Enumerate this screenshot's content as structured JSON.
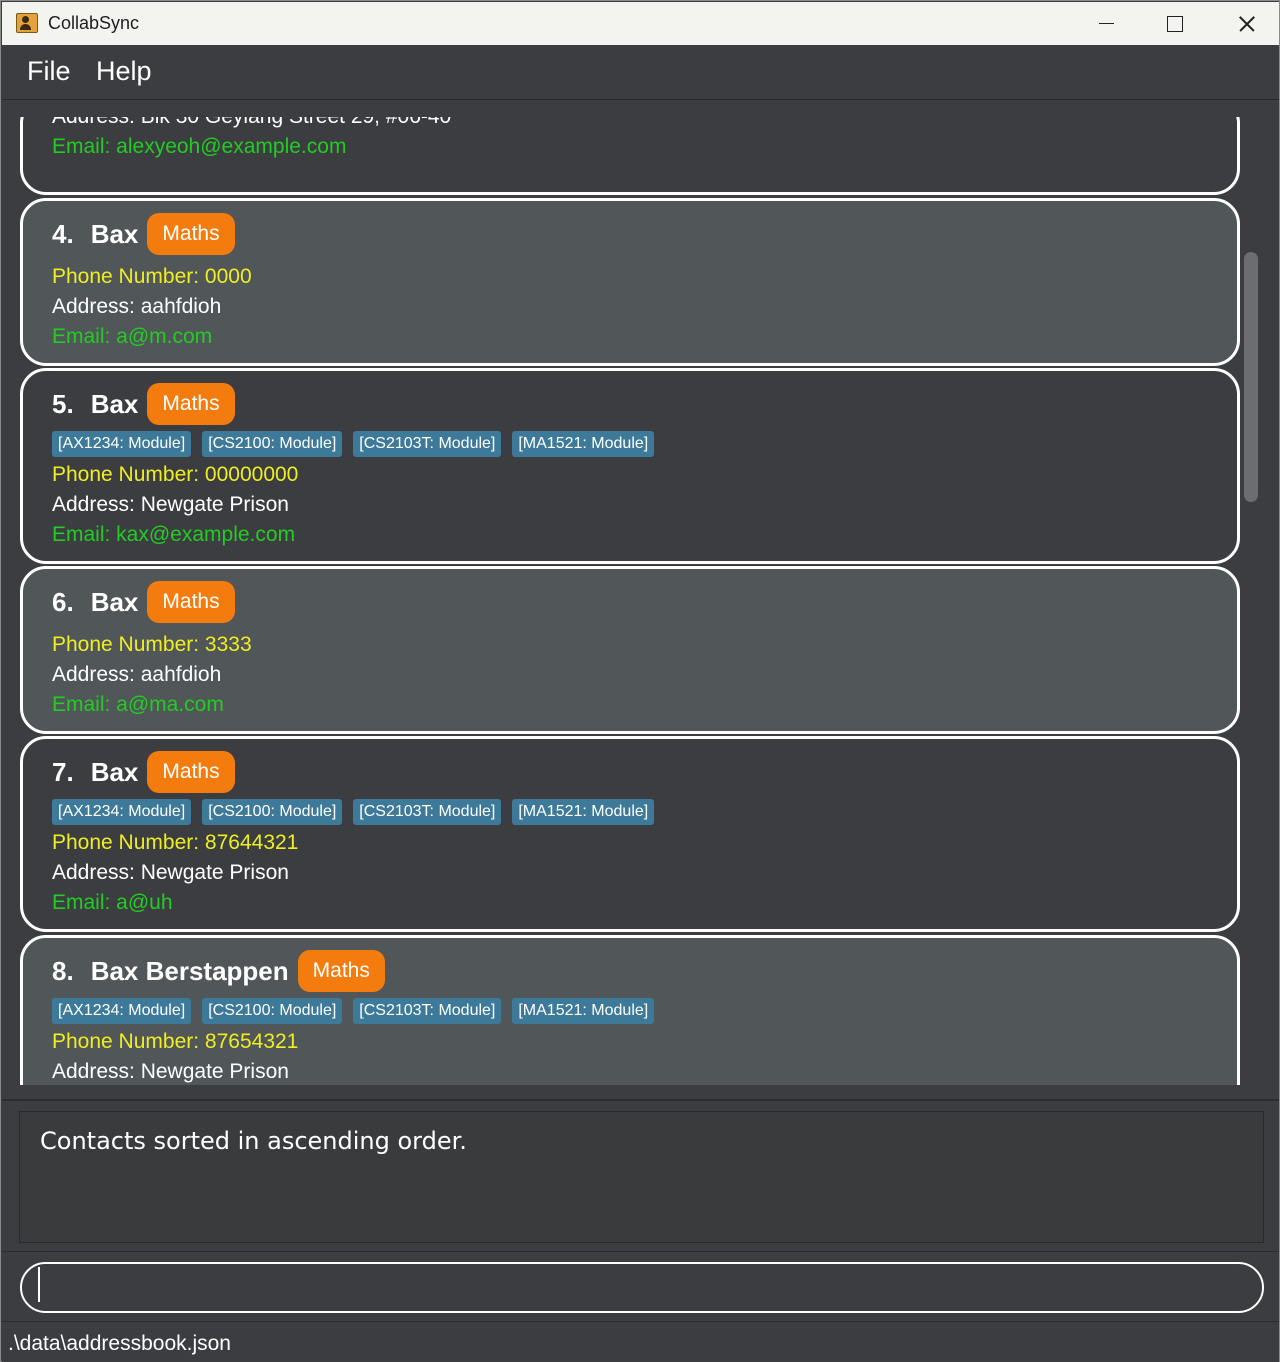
{
  "window": {
    "title": "CollabSync"
  },
  "menu": {
    "file": "File",
    "help": "Help"
  },
  "partial_card": {
    "address": "Address: Blk 30 Geylang Street 29, #06-40",
    "email": "Email: alexyeoh@example.com"
  },
  "contacts": [
    {
      "index": "4.",
      "name": "Bax",
      "subject": "Maths",
      "modules": [],
      "phone": "Phone Number: 0000",
      "address": "Address: aahfdioh",
      "email": "Email: a@m.com"
    },
    {
      "index": "5.",
      "name": "Bax",
      "subject": "Maths",
      "modules": [
        "[AX1234: Module]",
        "[CS2100: Module]",
        "[CS2103T: Module]",
        "[MA1521: Module]"
      ],
      "phone": "Phone Number: 00000000",
      "address": "Address: Newgate Prison",
      "email": "Email: kax@example.com"
    },
    {
      "index": "6.",
      "name": "Bax",
      "subject": "Maths",
      "modules": [],
      "phone": "Phone Number: 3333",
      "address": "Address: aahfdioh",
      "email": "Email: a@ma.com"
    },
    {
      "index": "7.",
      "name": "Bax",
      "subject": "Maths",
      "modules": [
        "[AX1234: Module]",
        "[CS2100: Module]",
        "[CS2103T: Module]",
        "[MA1521: Module]"
      ],
      "phone": "Phone Number: 87644321",
      "address": "Address: Newgate Prison",
      "email": "Email: a@uh"
    },
    {
      "index": "8.",
      "name": "Bax Berstappen",
      "subject": "Maths",
      "modules": [
        "[AX1234: Module]",
        "[CS2100: Module]",
        "[CS2103T: Module]",
        "[MA1521: Module]"
      ],
      "phone": "Phone Number: 87654321",
      "address": "Address: Newgate Prison",
      "email": ""
    }
  ],
  "result": {
    "message": "Contacts sorted in ascending order."
  },
  "command": {
    "value": ""
  },
  "status": {
    "file_path": ".\\data\\addressbook.json"
  }
}
